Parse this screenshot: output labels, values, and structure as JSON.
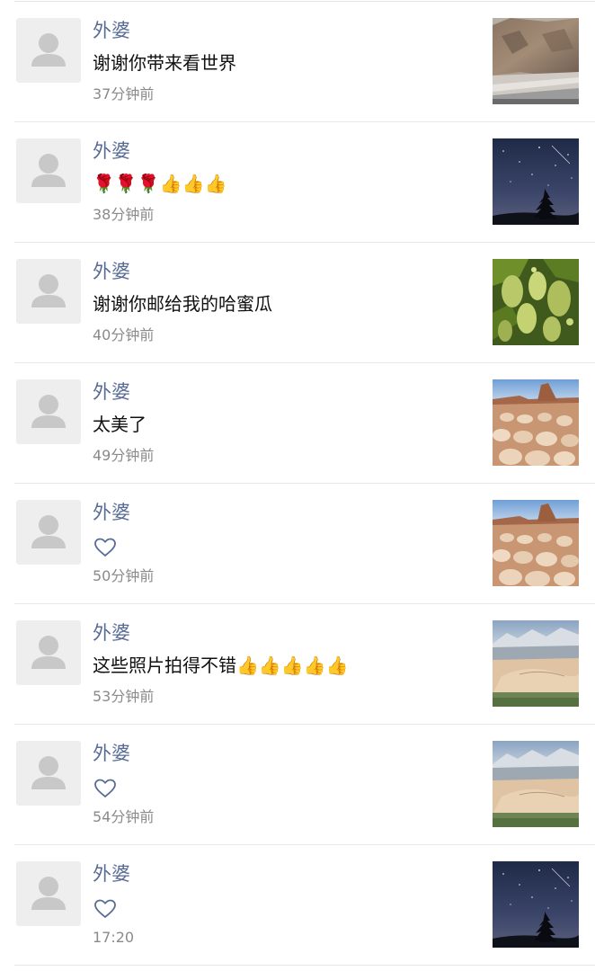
{
  "comments": [
    {
      "name": "外婆",
      "message": "谢谢你带来看世界",
      "time": "37分钟前",
      "thumbnail": "mountain-road-photo"
    },
    {
      "name": "外婆",
      "message": "🌹🌹🌹👍👍👍",
      "time": "38分钟前",
      "thumbnail": "starry-night-tree-photo"
    },
    {
      "name": "外婆",
      "message": "谢谢你邮给我的哈蜜瓜",
      "time": "40分钟前",
      "thumbnail": "grape-vine-photo"
    },
    {
      "name": "外婆",
      "message": "太美了",
      "time": "49分钟前",
      "thumbnail": "desert-stones-photo"
    },
    {
      "name": "外婆",
      "like_icon": "heart-icon",
      "time": "50分钟前",
      "thumbnail": "desert-stones-photo"
    },
    {
      "name": "外婆",
      "message": "这些照片拍得不错👍👍👍👍👍",
      "time": "53分钟前",
      "thumbnail": "sand-dunes-photo"
    },
    {
      "name": "外婆",
      "like_icon": "heart-icon",
      "time": "54分钟前",
      "thumbnail": "sand-dunes-photo"
    },
    {
      "name": "外婆",
      "like_icon": "heart-icon",
      "time": "17:20",
      "thumbnail": "starry-night-tree-photo"
    }
  ],
  "colors": {
    "name_color": "#576b95",
    "text_color": "#111111",
    "time_color": "#8a8a8a",
    "avatar_bg": "#eeeeee",
    "avatar_icon": "#c8c8c8",
    "divider": "#e8e8e8"
  }
}
